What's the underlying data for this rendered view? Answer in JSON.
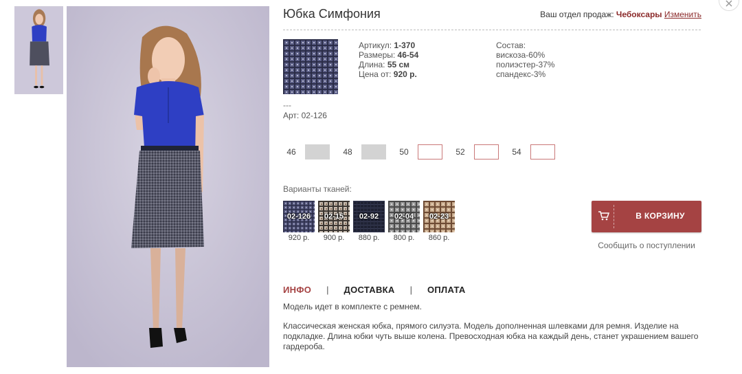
{
  "product": {
    "title": "Юбка Симфония",
    "sales_dept_label": "Ваш отдел продаж:",
    "sales_dept_city": "Чебоксары",
    "change_link": "Изменить"
  },
  "specs": {
    "article_label": "Артикул:",
    "article_value": "1-370",
    "sizes_label": "Размеры:",
    "sizes_value": "46-54",
    "length_label": "Длина:",
    "length_value": "55 см",
    "price_label": "Цена от:",
    "price_value": "920 р.",
    "composition_label": "Состав:",
    "composition": [
      "вискоза-60%",
      "полиэстер-37%",
      "спандекс-3%"
    ]
  },
  "fabric_dash": "---",
  "fabric_article": "Арт: 02-126",
  "sizes": [
    {
      "label": "46",
      "available": false
    },
    {
      "label": "48",
      "available": false
    },
    {
      "label": "50",
      "available": true
    },
    {
      "label": "52",
      "available": true
    },
    {
      "label": "54",
      "available": true
    }
  ],
  "fabrics_label": "Варианты тканей:",
  "fabrics": [
    {
      "code": "02-126",
      "price": "920 р.",
      "color": "#4a4e72"
    },
    {
      "code": "02-15",
      "price": "900 р.",
      "color": "#3c3631"
    },
    {
      "code": "02-92",
      "price": "880 р.",
      "color": "#1f2233"
    },
    {
      "code": "02-04",
      "price": "800 р.",
      "color": "#6b6b6b"
    },
    {
      "code": "02-23",
      "price": "860 р.",
      "color": "#a07a5e"
    }
  ],
  "cart": {
    "label": "В КОРЗИНУ",
    "notify": "Сообщить о поступлении"
  },
  "tabs": {
    "info": "ИНФО",
    "delivery": "ДОСТАВКА",
    "payment": "ОПЛАТА",
    "separator": "|"
  },
  "description": {
    "line1": "Модель идет в комплекте с ремнем.",
    "line2": "Классическая женская юбка, прямого силуэта. Модель дополненная шлевками для ремня. Изделие на подкладке. Длина юбки чуть выше колена. Превосходная юбка на каждый день, станет украшением вашего гардероба."
  },
  "colors": {
    "accent": "#a54343",
    "link": "#8b2a2a",
    "blouse": "#2e3fc4",
    "skirt": "#4e4f5e"
  },
  "icons": {
    "close": "close-icon",
    "cart": "cart-icon"
  }
}
